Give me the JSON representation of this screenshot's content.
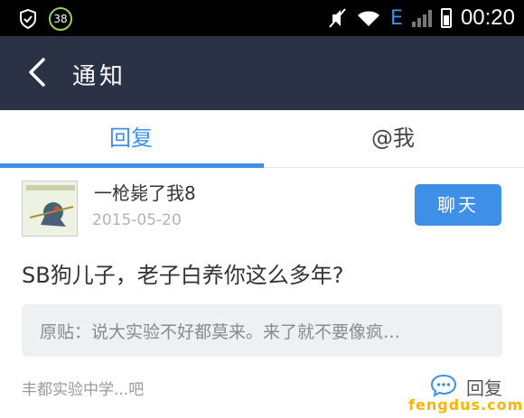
{
  "statusbar": {
    "notification_count": "38",
    "network_type": "E",
    "time": "00:20"
  },
  "header": {
    "title": "通知"
  },
  "tabs": [
    {
      "label": "回复",
      "selected": true
    },
    {
      "label": "@我",
      "selected": false
    }
  ],
  "notification": {
    "username": "一枪毙了我8",
    "date": "2015-05-20",
    "chat_label": "聊天",
    "message": "SB狗儿子，老子白养你这么多年?",
    "original_post": "原贴：说大实验不好都莫来。来了就不要像疯…",
    "forum": "丰都实验中学...吧",
    "reply_label": "回复"
  },
  "watermark": "fengdus.com",
  "colors": {
    "accent": "#3e8fe8",
    "titlebar": "#2b3246",
    "statusbar": "#000000",
    "watermark": "#ffb400"
  }
}
